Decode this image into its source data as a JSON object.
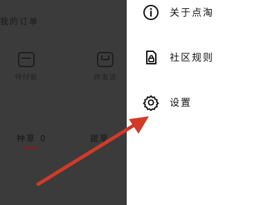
{
  "background_page": {
    "section_title": "我的订单",
    "order_items": [
      {
        "label": "待付款",
        "icon": "wallet-icon"
      },
      {
        "label": "待发货",
        "icon": "package-icon"
      }
    ],
    "tabs": [
      {
        "label": "种草 0"
      },
      {
        "label": "拔草"
      }
    ]
  },
  "drawer": {
    "items": [
      {
        "label": "关于点淘",
        "icon": "info-icon"
      },
      {
        "label": "社区规则",
        "icon": "lock-document-icon"
      },
      {
        "label": "设置",
        "icon": "gear-icon"
      }
    ]
  },
  "annotation": {
    "arrow_color": "#d23a28"
  },
  "colors": {
    "overlay": "#3b3b3b",
    "drawer_bg": "#ffffff",
    "tab_underline": "#7a1f1f"
  }
}
